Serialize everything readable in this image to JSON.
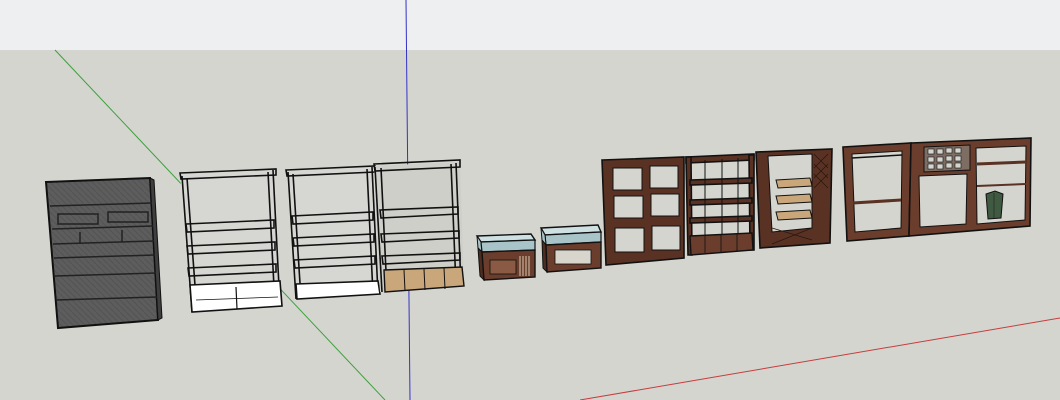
{
  "viewport": {
    "sky_color": "#eeeff0",
    "ground_color": "#d5d5d0"
  },
  "axes": {
    "red_axis_color": "#c83c3c",
    "green_axis_color": "#3ca03c",
    "blue_axis_color": "#3232c8"
  },
  "materials": {
    "dark_panel": "#5b5b5b",
    "wood_dark": "#5a3224",
    "wood_mid": "#6b3d2c",
    "wood_light": "#c9a77a",
    "glass": "#a9c4c9",
    "outline": "#111111",
    "white_part": "#ffffff"
  },
  "models": [
    {
      "name": "dark-bookcase-model"
    },
    {
      "name": "white-shelf-unit-1-model"
    },
    {
      "name": "white-shelf-unit-2-model"
    },
    {
      "name": "shelf-unit-with-drawers-model"
    },
    {
      "name": "glass-display-counter-1-model"
    },
    {
      "name": "glass-display-counter-2-model"
    },
    {
      "name": "wood-cubby-shelf-model"
    },
    {
      "name": "wood-shelf-with-drawers-model"
    },
    {
      "name": "wood-lattice-display-model"
    },
    {
      "name": "wood-hanging-rack-model"
    },
    {
      "name": "wood-wardrobe-with-shirt-model"
    }
  ]
}
